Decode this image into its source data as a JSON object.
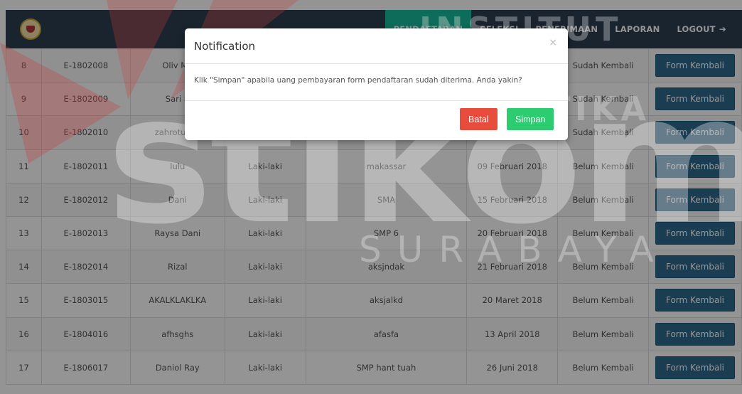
{
  "nav": {
    "items": [
      "PENDAFTARAN",
      "SELEKSI",
      "PENERIMAAN",
      "LAPORAN",
      "LOGOUT"
    ],
    "active_index": 0
  },
  "table": {
    "button_label": "Form Kembali",
    "rows": [
      [
        "8",
        "E-1802008",
        "Oliv Ma",
        "",
        "",
        "",
        "Sudah Kembali"
      ],
      [
        "9",
        "E-1802009",
        "Sari R",
        "",
        "",
        "",
        "Sudah Kembali"
      ],
      [
        "10",
        "E-1802010",
        "zahrotul ch",
        "",
        "",
        "",
        "Sudah Kembali"
      ],
      [
        "11",
        "E-1802011",
        "lulu",
        "Laki-laki",
        "makassar",
        "09 Februari 2018",
        "Belum Kembali"
      ],
      [
        "12",
        "E-1802012",
        "Dani",
        "Laki-laki",
        "SMA",
        "15 Februari 2018",
        "Belum Kembali"
      ],
      [
        "13",
        "E-1802013",
        "Raysa Dani",
        "Laki-laki",
        "SMP 6",
        "20 Februari 2018",
        "Belum Kembali"
      ],
      [
        "14",
        "E-1802014",
        "Rizal",
        "Laki-laki",
        "aksjndak",
        "21 Februari 2018",
        "Belum Kembali"
      ],
      [
        "15",
        "E-1803015",
        "AKALKLAKLKA",
        "Laki-laki",
        "aksjalkd",
        "20 Maret 2018",
        "Belum Kembali"
      ],
      [
        "16",
        "E-1804016",
        "afhsghs",
        "Laki-laki",
        "afasfa",
        "13 April 2018",
        "Belum Kembali"
      ],
      [
        "17",
        "E-1806017",
        "Daniol Ray",
        "Laki-laki",
        "SMP hant tuah",
        "26 Juni 2018",
        "Belum Kembali"
      ]
    ]
  },
  "modal": {
    "title": "Notification",
    "close": "×",
    "message": "Klik \"Simpan\" apabila uang pembayaran form pendaftaran sudah diterima. Anda yakin?",
    "cancel_label": "Batal",
    "confirm_label": "Simpan"
  },
  "watermark": {
    "line1": "INSTITUT BISNIS",
    "line2": "DAN INFORMATIKA",
    "brand": "stikom",
    "city": "SURABAYA"
  },
  "colors": {
    "navbar": "#2c3e50",
    "nav_active": "#18bc9c",
    "table_button": "#2f6a8d",
    "cancel": "#e74c3c",
    "confirm": "#2ecc71"
  }
}
